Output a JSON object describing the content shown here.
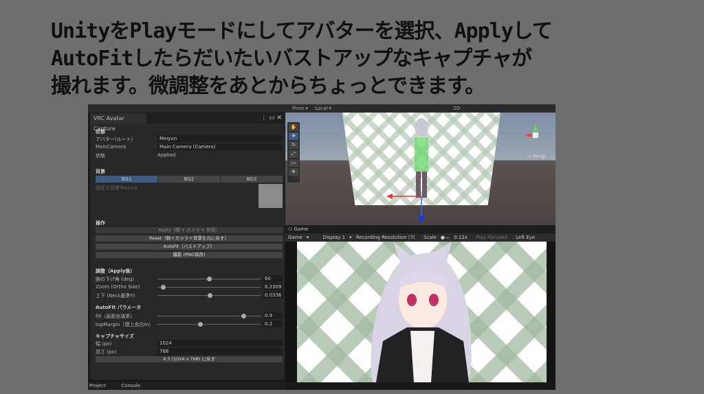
{
  "caption": {
    "lines": [
      "UnityをPlayモードにしてアバターを選択、Applyして",
      "AutoFitしたらだいたいバストアップなキャプチャが",
      "撮れます。微調整をあとからちょっとできます。"
    ]
  },
  "panel": {
    "title": "VRC Avatar Capture",
    "status_section": "状態",
    "avatar_label": "アバター(ルート)",
    "avatar_value": "Meiyun",
    "camera_label": "MainCamera",
    "camera_value": "Main Camera (Camera)",
    "state_label": "状態",
    "state_value": "Applied",
    "bg_section": "背景",
    "bg_buttons": [
      "BG1",
      "BG2",
      "BG3"
    ],
    "bg_texture_label": "現在の背景Texture",
    "ops_section": "操作",
    "apply": "Apply（腕 + カメラ + 背景）",
    "reset": "Reset（腕＋カメラ＋背景を元に戻す）",
    "autofit": "AutoFit（バストアップ）",
    "capture": "撮影 (PNG保存)",
    "adjust_section": "調整（Apply後）",
    "sliders": [
      {
        "label": "腕の下げ角 (deg)",
        "value": "60",
        "fraction": 0.5
      },
      {
        "label": "Zoom (Ortho Size)",
        "value": "0.2309",
        "fraction": 0.05
      },
      {
        "label": "上下 (Neck基準Y)",
        "value": "0.0336",
        "fraction": 0.51
      }
    ],
    "autofit_section": "AutoFit パラメータ",
    "autofit_sliders": [
      {
        "label": "fill（画面充填率）",
        "value": "0.9",
        "fraction": 0.83
      },
      {
        "label": "topMargin（頭上余白m）",
        "value": "0.2",
        "fraction": 0.42
      }
    ],
    "size_section": "キャプチャサイズ",
    "width_label": "幅 (px)",
    "width_value": "1024",
    "height_label": "高さ (px)",
    "height_value": "768",
    "reset_size": "4:3 (1024 x 768) に戻す"
  },
  "bottom_tabs": [
    "Project",
    "Console"
  ],
  "scene": {
    "pivot": "Pivot",
    "local": "Local",
    "mode2d": "2D",
    "persp": "< Persp"
  },
  "game": {
    "tab": "Game",
    "view": "Game",
    "display": "Display 1",
    "resolution": "Recording Resolution (7(",
    "scale_label": "Scale",
    "scale_value": "0.12x",
    "play_focused": "Play Focused",
    "eye": "Left Eye"
  }
}
